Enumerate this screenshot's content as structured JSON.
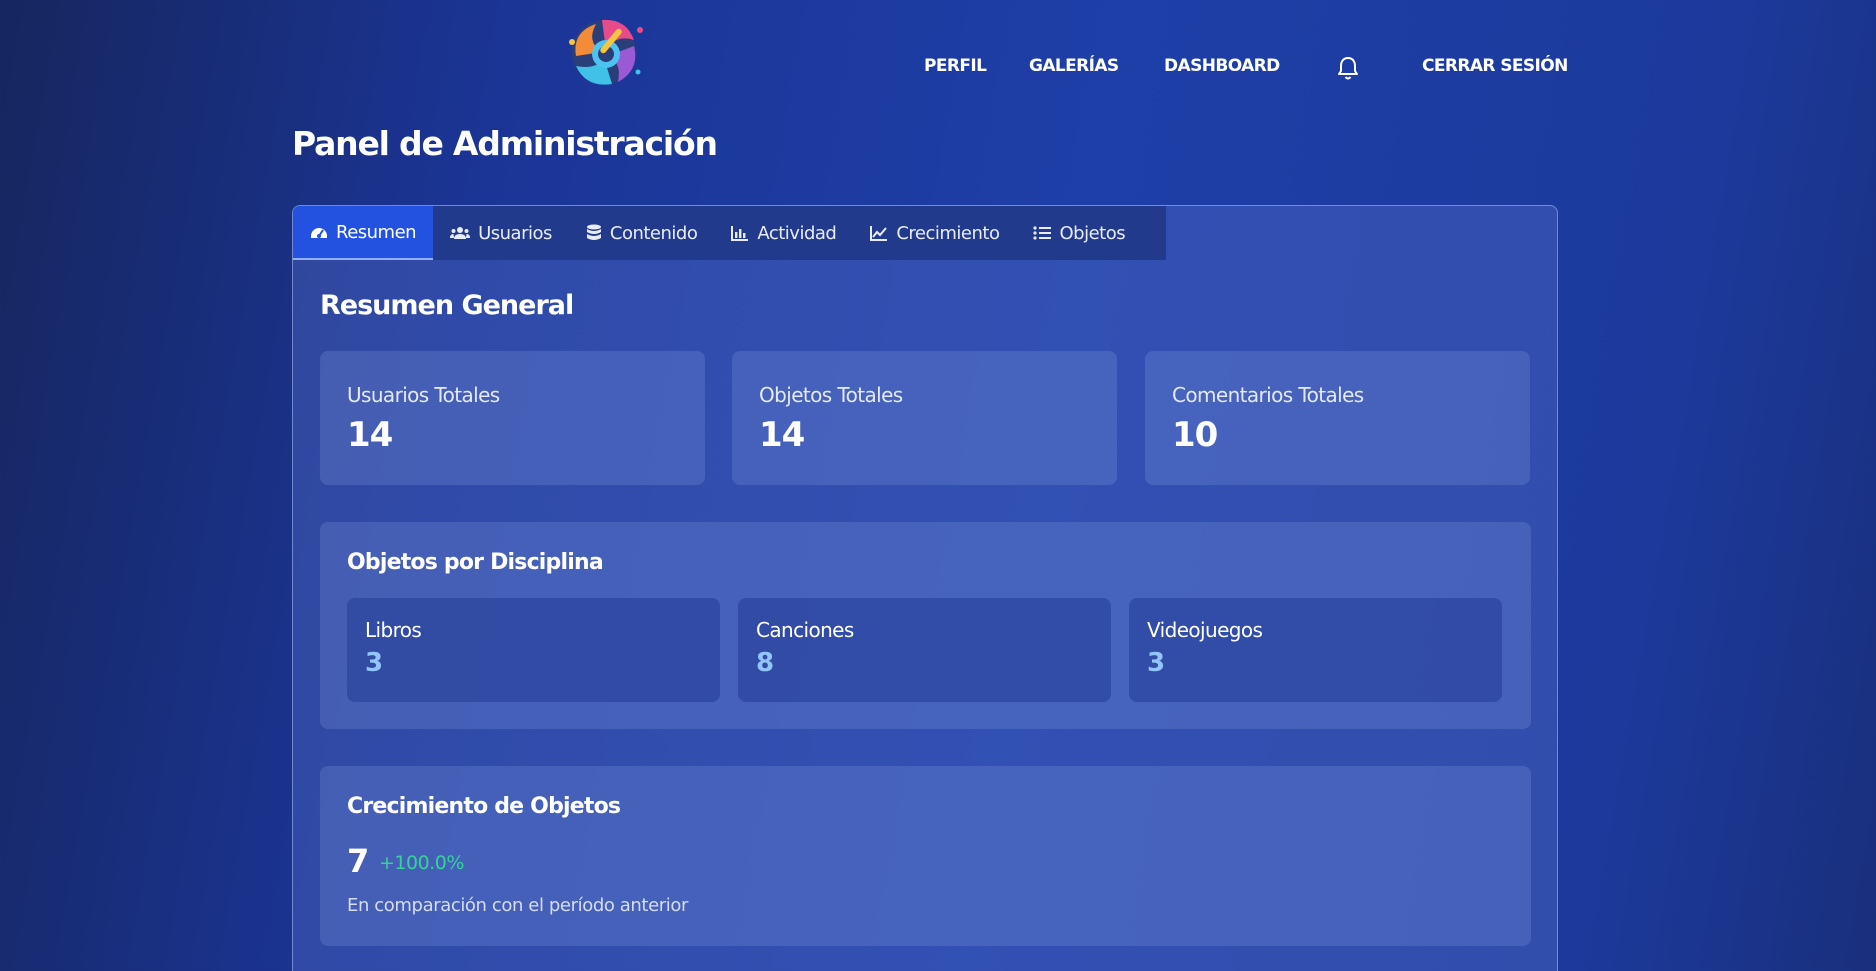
{
  "colors": {
    "background": "#1c3a9c",
    "active_tab": "#2452e0",
    "discipline_value": "#93c5fd",
    "growth_positive": "#34d399"
  },
  "header": {
    "logo_icon": "paint-palette-logo",
    "nav": {
      "perfil": "PERFIL",
      "galerias": "GALERÍAS",
      "dashboard": "DASHBOARD",
      "notifications_icon": "bell-icon",
      "logout": "CERRAR SESIÓN"
    }
  },
  "page_title": "Panel de Administración",
  "tabs": [
    {
      "label": "Resumen",
      "icon": "gauge-icon",
      "active": true
    },
    {
      "label": "Usuarios",
      "icon": "users-icon",
      "active": false
    },
    {
      "label": "Contenido",
      "icon": "database-icon",
      "active": false
    },
    {
      "label": "Actividad",
      "icon": "bar-chart-icon",
      "active": false
    },
    {
      "label": "Crecimiento",
      "icon": "line-chart-icon",
      "active": false
    },
    {
      "label": "Objetos",
      "icon": "list-icon",
      "active": false
    }
  ],
  "summary": {
    "title": "Resumen General",
    "stats": [
      {
        "label": "Usuarios Totales",
        "value": "14"
      },
      {
        "label": "Objetos Totales",
        "value": "14"
      },
      {
        "label": "Comentarios Totales",
        "value": "10"
      }
    ]
  },
  "disciplines": {
    "title": "Objetos por Disciplina",
    "items": [
      {
        "label": "Libros",
        "value": "3"
      },
      {
        "label": "Canciones",
        "value": "8"
      },
      {
        "label": "Videojuegos",
        "value": "3"
      }
    ]
  },
  "growth": {
    "title": "Crecimiento de Objetos",
    "value": "7",
    "change": "+100.0%",
    "note": "En comparación con el período anterior"
  }
}
